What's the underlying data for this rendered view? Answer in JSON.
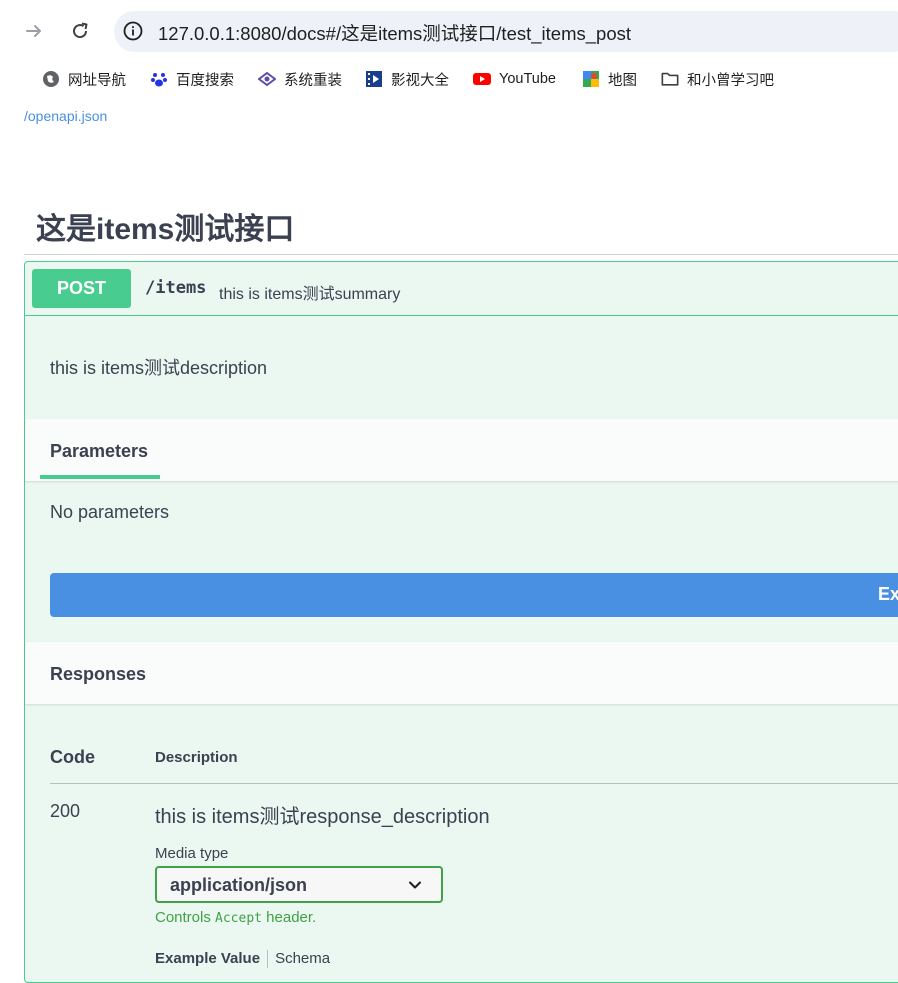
{
  "browser": {
    "url": "127.0.0.1:8080/docs#/这是items测试接口/test_items_post",
    "bookmarks": [
      {
        "label": "网址导航",
        "icon": "globe-icon"
      },
      {
        "label": "百度搜索",
        "icon": "baidu-paw-icon"
      },
      {
        "label": "系统重装",
        "icon": "system-reinstall-icon"
      },
      {
        "label": "影视大全",
        "icon": "film-icon"
      },
      {
        "label": "YouTube",
        "icon": "youtube-icon"
      },
      {
        "label": "地图",
        "icon": "maps-icon"
      },
      {
        "label": "和小曾学习吧",
        "icon": "folder-icon"
      }
    ]
  },
  "page": {
    "openapi_link": "/openapi.json",
    "tag_title": "这是items测试接口"
  },
  "operation": {
    "method": "POST",
    "path": "/items",
    "summary": "this is items测试summary",
    "description": "this is items测试description",
    "parameters_tab": "Parameters",
    "no_parameters": "No parameters",
    "execute_label": "Ex",
    "responses_label": "Responses",
    "responses_table": {
      "code_header": "Code",
      "description_header": "Description",
      "rows": [
        {
          "code": "200",
          "description": "this is items测试response_description",
          "media_type_label": "Media type",
          "media_type_value": "application/json",
          "controls_prefix": "Controls",
          "controls_code": "Accept",
          "controls_suffix": "header.",
          "example_value_tab": "Example Value",
          "schema_tab": "Schema"
        }
      ]
    }
  },
  "colors": {
    "post_green": "#49cc90",
    "opblock_bg": "#ebf7f1",
    "execute_blue": "#4990e2",
    "link_blue": "#4990e2",
    "select_border": "#41a146"
  }
}
